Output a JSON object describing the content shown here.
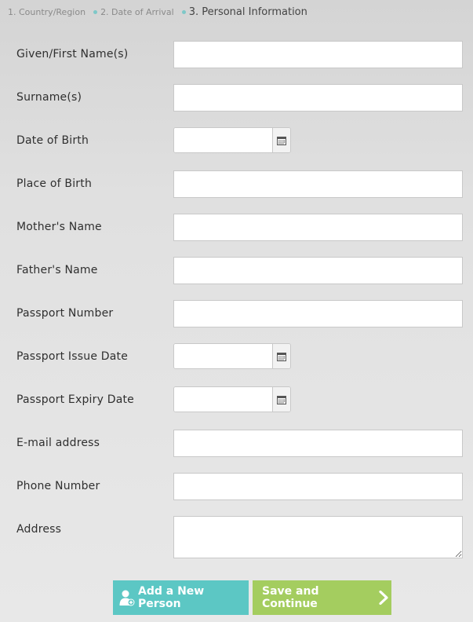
{
  "steps": [
    {
      "label": "1. Country/Region"
    },
    {
      "label": "2. Date of Arrival"
    },
    {
      "label": "3. Personal Information"
    }
  ],
  "fields": {
    "given_name": {
      "label": "Given/First Name(s)",
      "value": ""
    },
    "surname": {
      "label": "Surname(s)",
      "value": ""
    },
    "date_of_birth": {
      "label": "Date of Birth",
      "value": ""
    },
    "place_of_birth": {
      "label": "Place of Birth",
      "value": ""
    },
    "mothers_name": {
      "label": "Mother's Name",
      "value": ""
    },
    "fathers_name": {
      "label": "Father's Name",
      "value": ""
    },
    "passport_number": {
      "label": "Passport Number",
      "value": ""
    },
    "passport_issue_date": {
      "label": "Passport Issue Date",
      "value": ""
    },
    "passport_expiry_date": {
      "label": "Passport Expiry Date",
      "value": ""
    },
    "email": {
      "label": "E-mail address",
      "value": ""
    },
    "phone": {
      "label": "Phone Number",
      "value": ""
    },
    "address": {
      "label": "Address",
      "value": ""
    }
  },
  "buttons": {
    "add_person": "Add a New Person",
    "save_continue": "Save and Continue"
  },
  "colors": {
    "add_button": "#5cc7c4",
    "save_button": "#a4cd5f",
    "step_dot": "#7ec8c8"
  },
  "icons": {
    "calendar": "calendar-icon",
    "add_person": "add-person-icon",
    "continue": "chevron-right-icon"
  }
}
